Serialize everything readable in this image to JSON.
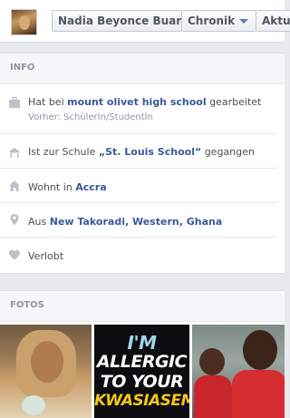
{
  "header": {
    "profile_name": "Nadia Beyonce Buari",
    "chronik_label": "Chronik",
    "next_tab_partial": "Aktu"
  },
  "info": {
    "heading": "INFO",
    "work": {
      "prefix": "Hat bei ",
      "link": "mount olivet high school",
      "suffix": " gearbeitet",
      "sub": "Vorher: SchülerIn/StudentIn"
    },
    "school": {
      "prefix": "Ist zur Schule ",
      "link": "„St. Louis School“",
      "suffix": " gegangen"
    },
    "lives": {
      "prefix": "Wohnt in ",
      "link": "Accra"
    },
    "from": {
      "prefix": "Aus ",
      "link": "New Takoradi, Western, Ghana"
    },
    "relationship": {
      "text": "Verlobt"
    }
  },
  "photos": {
    "heading": "FOTOS",
    "items": [
      {
        "name": "photo-1"
      },
      {
        "name": "photo-2",
        "lines": [
          "I'M",
          "ALLERGIC",
          "TO YOUR",
          "KWASIASEM"
        ]
      },
      {
        "name": "photo-3"
      }
    ]
  },
  "colors": {
    "link": "#3b5998",
    "muted": "#90949c",
    "background": "#e9eaed"
  }
}
